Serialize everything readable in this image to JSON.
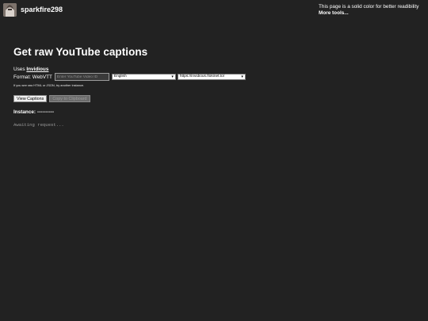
{
  "header": {
    "username": "sparkfire298",
    "avatar_icon": "avatar-image-icon"
  },
  "notice": {
    "text": "This page is a solid color for better readibility",
    "more_tools": "More tools..."
  },
  "title": "Get raw YouTube captions",
  "uses": {
    "prefix": "Uses ",
    "link": "Invidious"
  },
  "form": {
    "format_label": "Format: WebVTT",
    "video_id_placeholder": "Enter YouTube Video ID",
    "language_selected": "English",
    "instance_selected": "https://invidious.flokinet.to/",
    "hint": "If you see raw HTML or JSON, try another instance."
  },
  "buttons": {
    "view_captions": "View Captions",
    "copy_clipboard": "Copy to Clipboard"
  },
  "instance": {
    "label": "Instance:",
    "value": "----------"
  },
  "output": {
    "text": "Awaiting request..."
  },
  "colors": {
    "background": "#222222",
    "text": "#ffffff",
    "muted": "#9a9a9a"
  }
}
